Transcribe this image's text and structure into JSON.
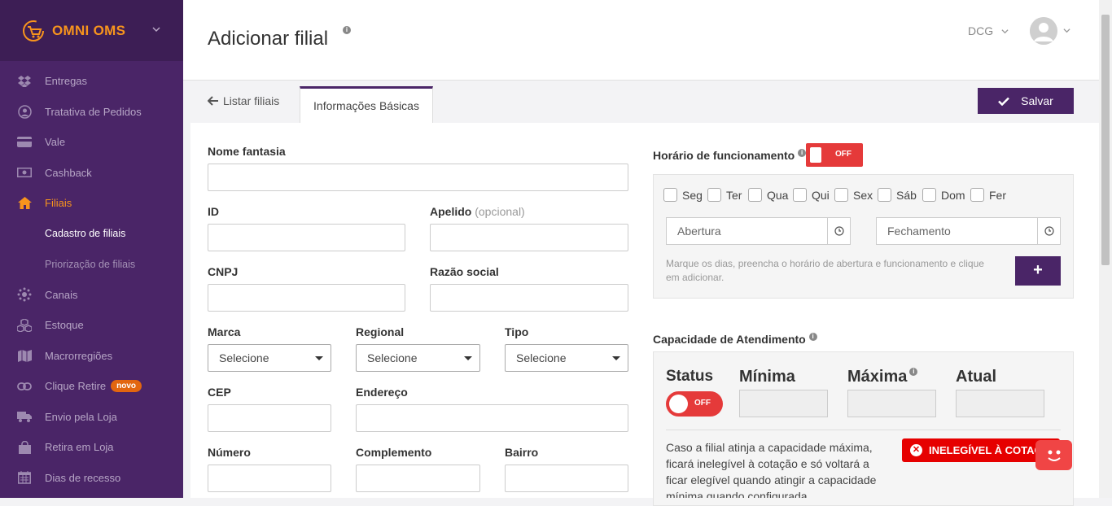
{
  "sidebar": {
    "brand": "OMNI OMS",
    "items": [
      {
        "label": "Entregas",
        "icon": "dropbox-icon"
      },
      {
        "label": "Tratativa de Pedidos",
        "icon": "user-circle-icon"
      },
      {
        "label": "Vale",
        "icon": "credit-card-icon"
      },
      {
        "label": "Cashback",
        "icon": "money-icon"
      },
      {
        "label": "Filiais",
        "icon": "home-icon",
        "active": true
      },
      {
        "label": "Cadastro de filiais",
        "sub": true,
        "active": true
      },
      {
        "label": "Priorização de filiais",
        "sub": true
      },
      {
        "label": "Canais",
        "icon": "network-icon"
      },
      {
        "label": "Estoque",
        "icon": "cubes-icon"
      },
      {
        "label": "Macrorregiões",
        "icon": "map-icon"
      },
      {
        "label": "Clique Retire",
        "icon": "link-icon",
        "badge": "novo"
      },
      {
        "label": "Envio pela Loja",
        "icon": "truck-icon"
      },
      {
        "label": "Retira em Loja",
        "icon": "shopping-bag-icon"
      },
      {
        "label": "Dias de recesso",
        "icon": "calendar-icon"
      }
    ]
  },
  "header": {
    "title": "Adicionar filial",
    "store": "DCG"
  },
  "tabs": {
    "back": "Listar filiais",
    "active": "Informações Básicas",
    "save": "Salvar"
  },
  "form": {
    "nome_fantasia": "Nome fantasia",
    "id": "ID",
    "apelido": "Apelido",
    "apelido_opt": "(opcional)",
    "cnpj": "CNPJ",
    "razao_social": "Razão social",
    "marca": "Marca",
    "regional": "Regional",
    "tipo": "Tipo",
    "select_placeholder": "Selecione",
    "cep": "CEP",
    "endereco": "Endereço",
    "numero": "Número",
    "complemento": "Complemento",
    "bairro": "Bairro"
  },
  "horario": {
    "label": "Horário de funcionamento",
    "toggle": "OFF",
    "days": [
      "Seg",
      "Ter",
      "Qua",
      "Qui",
      "Sex",
      "Sáb",
      "Dom",
      "Fer"
    ],
    "abertura": "Abertura",
    "fechamento": "Fechamento",
    "hint": "Marque os dias, preencha o horário de abertura e funcionamento e clique em adicionar.",
    "add": "+"
  },
  "capacidade": {
    "label": "Capacidade de Atendimento",
    "status": "Status",
    "minima": "Mínima",
    "maxima": "Máxima",
    "atual": "Atual",
    "toggle": "OFF",
    "text": "Caso a filial atinja a capacidade máxima, ficará inelegível à cotação e só voltará a ficar elegível quando atingir a capacidade mínima quando configurada.",
    "badge": "INELEGÍVEL À COTAÇÃO"
  },
  "colors": {
    "sidebar": "#4a2567",
    "accent": "#f7941d",
    "danger": "#e53a3a"
  }
}
